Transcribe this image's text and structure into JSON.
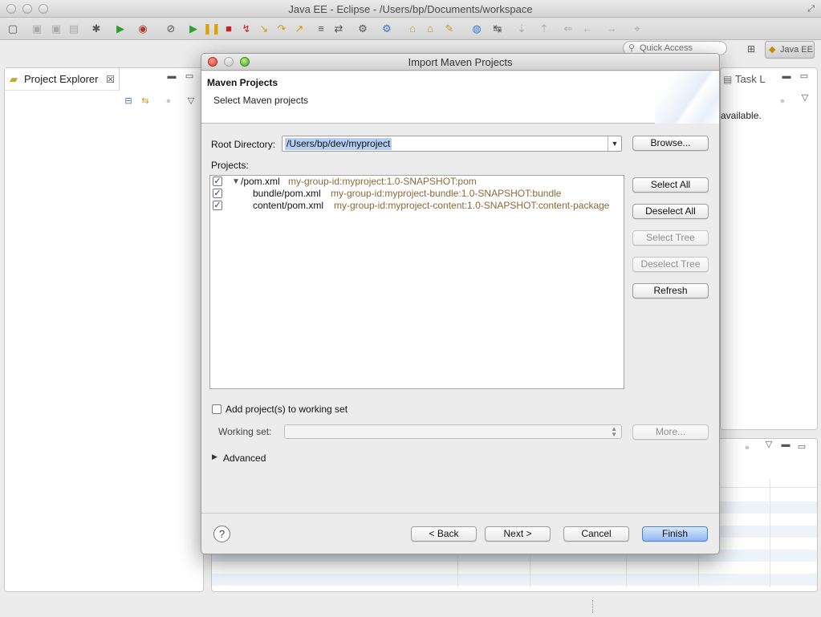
{
  "window": {
    "title": "Java EE - Eclipse - /Users/bp/Documents/workspace"
  },
  "quick_access": {
    "placeholder": "Quick Access"
  },
  "perspective": {
    "label": "Java EE"
  },
  "project_explorer": {
    "tab_label": "Project Explorer"
  },
  "task_view": {
    "tab_label": "Task L",
    "message_fragment": "available."
  },
  "dialog": {
    "title": "Import Maven Projects",
    "header_title": "Maven Projects",
    "header_subtitle": "Select Maven projects",
    "root_dir_label": "Root Directory:",
    "root_dir_value": "/Users/bp/dev/myproject",
    "browse_label": "Browse...",
    "projects_label": "Projects:",
    "projects": [
      {
        "name": "/pom.xml",
        "gav": "my-group-id:myproject:1.0-SNAPSHOT:pom",
        "checked": true
      },
      {
        "name": "bundle/pom.xml",
        "gav": "my-group-id:myproject-bundle:1.0-SNAPSHOT:bundle",
        "checked": true
      },
      {
        "name": "content/pom.xml",
        "gav": "my-group-id:myproject-content:1.0-SNAPSHOT:content-package",
        "checked": true
      }
    ],
    "side_buttons": {
      "select_all": "Select All",
      "deselect_all": "Deselect All",
      "select_tree": "Select Tree",
      "deselect_tree": "Deselect Tree",
      "refresh": "Refresh"
    },
    "working_set_checkbox_label": "Add project(s) to working set",
    "working_set_label": "Working set:",
    "working_set_value": "",
    "more_label": "More...",
    "advanced_label": "Advanced",
    "footer": {
      "back": "< Back",
      "next": "Next >",
      "cancel": "Cancel",
      "finish": "Finish"
    }
  }
}
